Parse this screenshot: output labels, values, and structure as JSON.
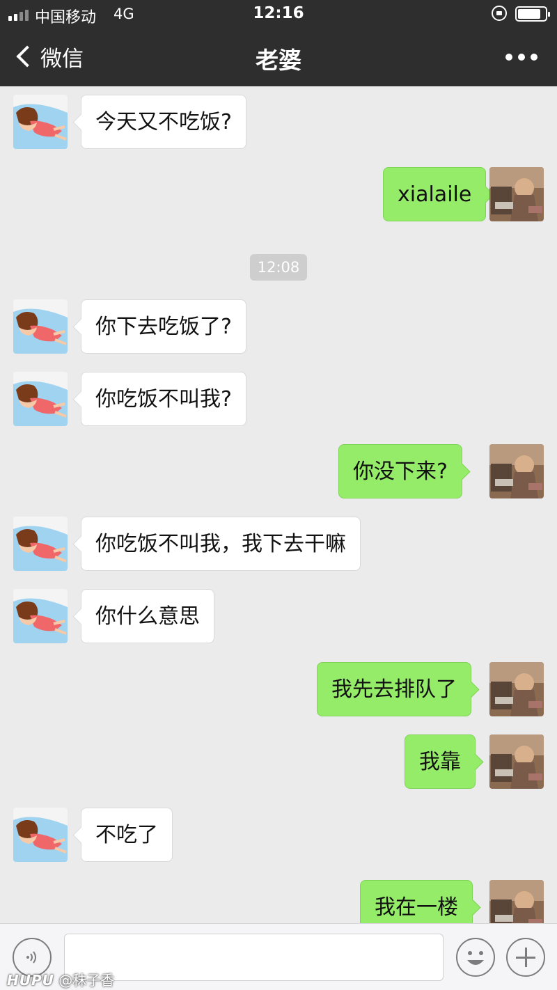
{
  "status_bar": {
    "carrier": "中国移动",
    "network": "4G",
    "time": "12:16"
  },
  "nav": {
    "back_label": "微信",
    "title": "老婆"
  },
  "chat": {
    "timestamp": "12:08",
    "messages": [
      {
        "from": "them",
        "text": "今天又不吃饭?"
      },
      {
        "from": "me",
        "text": "xialaile"
      },
      {
        "from": "them",
        "text": "你下去吃饭了?"
      },
      {
        "from": "them",
        "text": "你吃饭不叫我?"
      },
      {
        "from": "me",
        "text": "你没下来?"
      },
      {
        "from": "them",
        "text": "你吃饭不叫我，我下去干嘛"
      },
      {
        "from": "them",
        "text": "你什么意思"
      },
      {
        "from": "me",
        "text": "我先去排队了"
      },
      {
        "from": "me",
        "text": "我靠"
      },
      {
        "from": "them",
        "text": "不吃了"
      },
      {
        "from": "me",
        "text": "我在一楼"
      }
    ]
  },
  "input_bar": {
    "input_value": "",
    "icons": [
      "voice-icon",
      "emoji-icon",
      "plus-icon"
    ]
  },
  "watermark": {
    "brand": "HUPU",
    "handle": "@秣子香"
  },
  "colors": {
    "bar_background": "#2e2e2e",
    "chat_background": "#ebebeb",
    "outgoing_bubble": "#95ec69",
    "incoming_bubble": "#ffffff"
  }
}
